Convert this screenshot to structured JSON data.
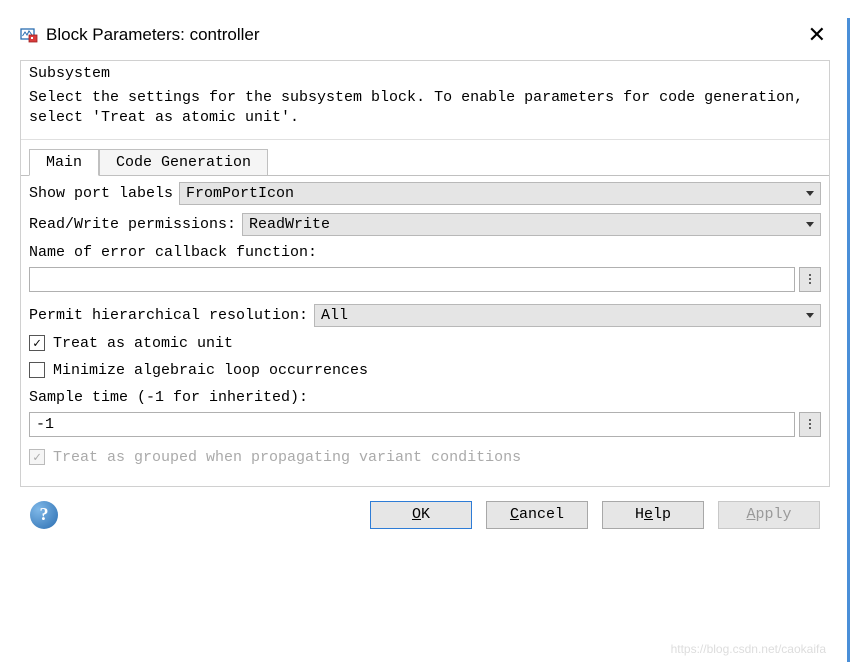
{
  "window": {
    "title": "Block Parameters: controller"
  },
  "section": {
    "header": "Subsystem",
    "description": "Select the settings for the subsystem block. To enable parameters for code generation, select 'Treat as atomic unit'."
  },
  "tabs": {
    "main": "Main",
    "codegen": "Code Generation"
  },
  "form": {
    "show_port_labels": {
      "label": "Show port labels",
      "value": "FromPortIcon"
    },
    "rw_perms": {
      "label": "Read/Write permissions:",
      "value": "ReadWrite"
    },
    "error_callback": {
      "label": "Name of error callback function:",
      "value": ""
    },
    "permit_hier": {
      "label": "Permit hierarchical resolution:",
      "value": "All"
    },
    "treat_atomic": {
      "label": "Treat as atomic unit",
      "checked": true
    },
    "min_alg_loop": {
      "label": "Minimize algebraic loop occurrences",
      "checked": false
    },
    "sample_time": {
      "label": "Sample time (-1 for inherited):",
      "value": "-1"
    },
    "treat_grouped": {
      "label": "Treat as grouped when propagating variant conditions",
      "checked": true
    }
  },
  "buttons": {
    "ok": "OK",
    "cancel": "Cancel",
    "help": "Help",
    "apply": "Apply"
  },
  "watermark": "https://blog.csdn.net/caokaifa"
}
